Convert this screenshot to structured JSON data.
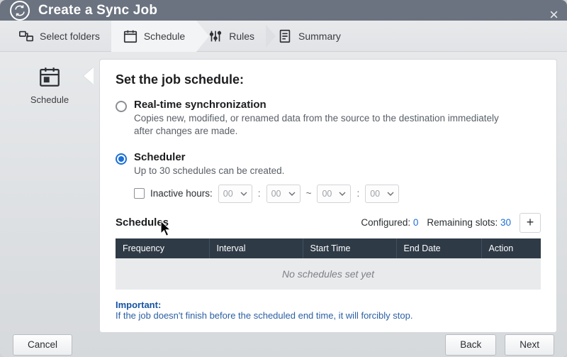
{
  "header": {
    "title": "Create a Sync Job"
  },
  "steps": {
    "select_folders": "Select folders",
    "schedule": "Schedule",
    "rules": "Rules",
    "summary": "Summary"
  },
  "rail": {
    "label": "Schedule"
  },
  "panel": {
    "heading": "Set the job schedule:",
    "realtime": {
      "title": "Real-time synchronization",
      "desc": "Copies new, modified, or renamed data from the source to the destination immediately after changes are made."
    },
    "scheduler": {
      "title": "Scheduler",
      "desc": "Up to 30 schedules can be created."
    },
    "inactive": {
      "label": "Inactive hours:",
      "h1": "00",
      "m1": "00",
      "h2": "00",
      "m2": "00"
    },
    "schedules": {
      "title": "Schedules",
      "configured_label": "Configured:",
      "configured_value": "0",
      "remaining_label": "Remaining slots:",
      "remaining_value": "30",
      "cols": {
        "freq": "Frequency",
        "interval": "Interval",
        "start": "Start Time",
        "end": "End Date",
        "action": "Action"
      },
      "empty": "No schedules set yet"
    },
    "important": {
      "label": "Important:",
      "text": "If the job doesn't finish before the scheduled end time, it will forcibly stop."
    }
  },
  "footer": {
    "cancel": "Cancel",
    "back": "Back",
    "next": "Next"
  }
}
